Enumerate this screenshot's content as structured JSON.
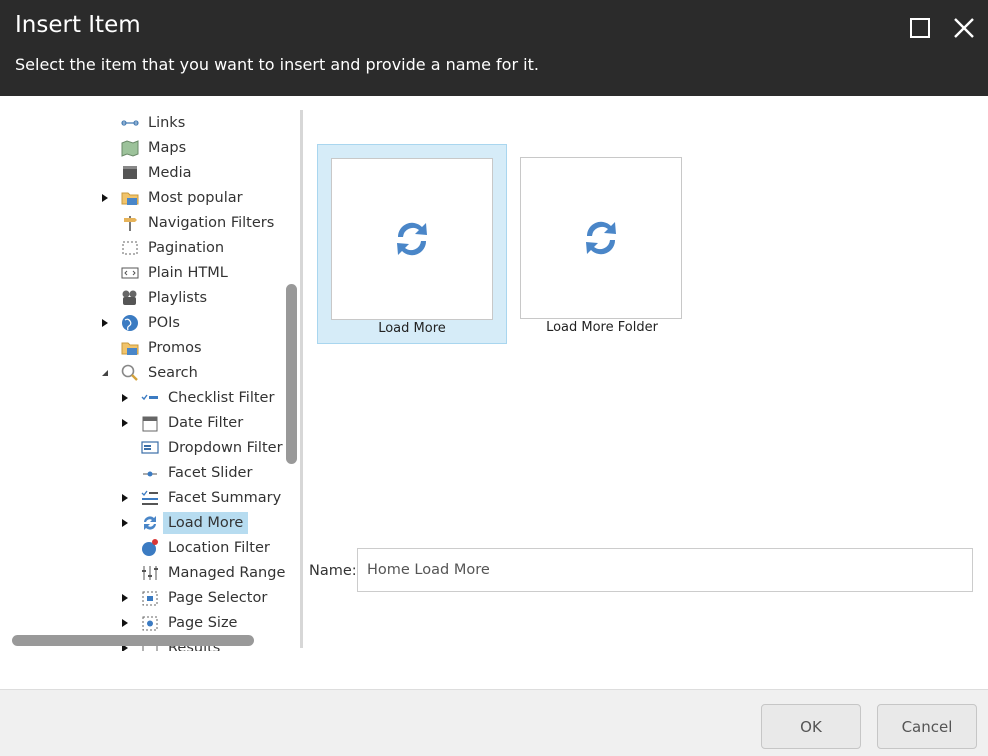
{
  "dialog": {
    "title": "Insert Item",
    "subtitle": "Select the item that you want to insert and provide a name for it."
  },
  "tree": {
    "items": [
      {
        "label": "Links",
        "icon": "links-icon",
        "expander": "none"
      },
      {
        "label": "Maps",
        "icon": "map-icon",
        "expander": "none"
      },
      {
        "label": "Media",
        "icon": "media-icon",
        "expander": "none"
      },
      {
        "label": "Most popular",
        "icon": "folder-icon",
        "expander": "collapsed"
      },
      {
        "label": "Navigation Filters",
        "icon": "signpost-icon",
        "expander": "none"
      },
      {
        "label": "Pagination",
        "icon": "pagination-icon",
        "expander": "none"
      },
      {
        "label": "Plain HTML",
        "icon": "code-icon",
        "expander": "none"
      },
      {
        "label": "Playlists",
        "icon": "film-camera-icon",
        "expander": "none"
      },
      {
        "label": "POIs",
        "icon": "globe-icon",
        "expander": "collapsed"
      },
      {
        "label": "Promos",
        "icon": "folder-icon",
        "expander": "none"
      },
      {
        "label": "Search",
        "icon": "magnifier-icon",
        "expander": "expanded"
      },
      {
        "label": "Checklist Filter",
        "icon": "checklist-icon",
        "expander": "collapsed"
      },
      {
        "label": "Date Filter",
        "icon": "calendar-icon",
        "expander": "collapsed"
      },
      {
        "label": "Dropdown Filter",
        "icon": "dropdown-icon",
        "expander": "none"
      },
      {
        "label": "Facet Slider",
        "icon": "slider-icon",
        "expander": "none"
      },
      {
        "label": "Facet Summary",
        "icon": "summary-list-icon",
        "expander": "collapsed"
      },
      {
        "label": "Load More",
        "icon": "refresh-icon",
        "expander": "collapsed",
        "selected": true
      },
      {
        "label": "Location Filter",
        "icon": "globe-pin-icon",
        "expander": "none"
      },
      {
        "label": "Managed Range",
        "icon": "range-sliders-icon",
        "expander": "none"
      },
      {
        "label": "Page Selector",
        "icon": "page-selector-icon",
        "expander": "collapsed"
      },
      {
        "label": "Page Size",
        "icon": "page-size-icon",
        "expander": "collapsed"
      },
      {
        "label": "Results",
        "icon": "results-icon",
        "expander": "collapsed"
      }
    ]
  },
  "templates": [
    {
      "label": "Load More",
      "icon": "refresh-icon",
      "selected": true
    },
    {
      "label": "Load More Folder",
      "icon": "refresh-icon",
      "selected": false
    }
  ],
  "name_field": {
    "label": "Name:",
    "value": "Home Load More"
  },
  "buttons": {
    "ok": "OK",
    "cancel": "Cancel"
  },
  "colors": {
    "header_bg": "#2b2b2b",
    "selection_bg": "#b7dcf0",
    "tile_selected_bg": "#d6ecf8",
    "icon_blue": "#4a86c8"
  }
}
